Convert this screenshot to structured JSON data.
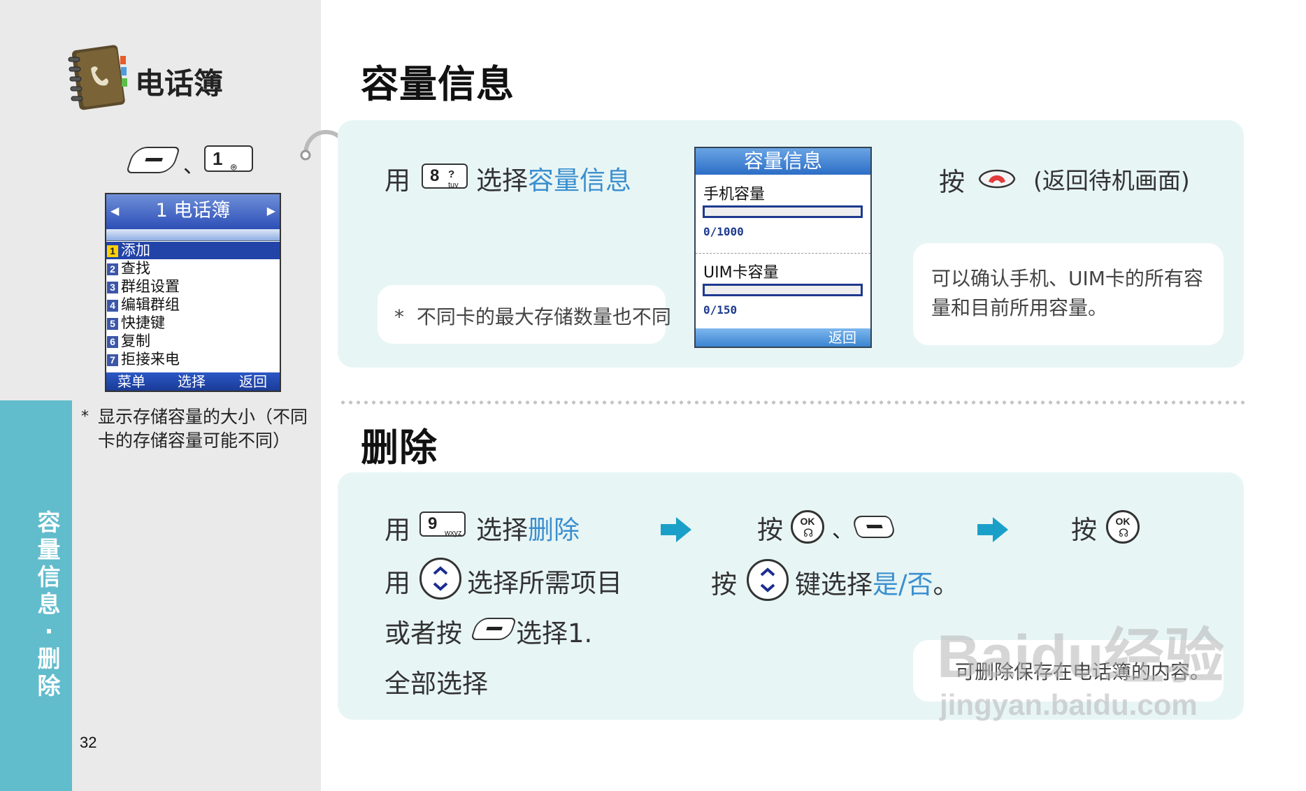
{
  "sidebar": {
    "title": "电话簿",
    "vertical_tab": [
      "容",
      "量",
      "信",
      "息",
      "·",
      "删",
      "除"
    ],
    "page_number": "32",
    "key_separator": "、",
    "key_1_label": "1",
    "note": "显示存储容量的大小（不同卡的存储容量可能不同）",
    "note_marker": "*"
  },
  "phone_menu": {
    "header": "1 电话簿",
    "items": [
      {
        "num": "1",
        "label": "添加"
      },
      {
        "num": "2",
        "label": "查找"
      },
      {
        "num": "3",
        "label": "群组设置"
      },
      {
        "num": "4",
        "label": "编辑群组"
      },
      {
        "num": "5",
        "label": "快捷键"
      },
      {
        "num": "6",
        "label": "复制"
      },
      {
        "num": "7",
        "label": "拒接来电"
      }
    ],
    "selected_index": 0,
    "softkeys": {
      "left": "菜单",
      "center": "选择",
      "right": "返回"
    }
  },
  "section1": {
    "heading": "容量信息",
    "step1_prefix": "用",
    "step1_key": "8",
    "step1_key_sub": "tuv",
    "step1_key_sym": "?",
    "step1_mid": "选择",
    "step1_target": "容量信息",
    "note_marker": "*",
    "note": "不同卡的最大存储数量也不同",
    "screen": {
      "title": "容量信息",
      "phone_label": "手机容量",
      "phone_value": "0/1000",
      "uim_label": "UIM卡容量",
      "uim_value": "0/150",
      "softkey": "返回"
    },
    "step2_prefix": "按",
    "step2_suffix": "(返回待机画面)",
    "info": "可以确认手机、UIM卡的所有容量和目前所用容量。"
  },
  "section2": {
    "heading": "删除",
    "line1_prefix": "用",
    "line1_key": "9",
    "line1_key_sub": "wxyz",
    "line1_mid": "选择",
    "line1_target": "删除",
    "line2_prefix": "用",
    "line2_suffix": "选择所需项目",
    "line3_prefix": "或者按",
    "line3_suffix": "选择1.",
    "line4": "全部选择",
    "step2_prefix": "按",
    "step2_sep": "、",
    "step2b_prefix": "按",
    "step2b_mid": "键选择",
    "step2b_target": "是/否",
    "step2b_end": "。",
    "step3_prefix": "按",
    "ok_label": "OK",
    "info": "可删除保存在电话簿的内容。"
  },
  "watermark": {
    "brand": "Baidu经验",
    "url": "jingyan.baidu.com"
  },
  "colors": {
    "accent": "#3a8fcf",
    "tab": "#61bccc",
    "panel": "#e8f5f5",
    "arrow": "#1aa0c8"
  }
}
